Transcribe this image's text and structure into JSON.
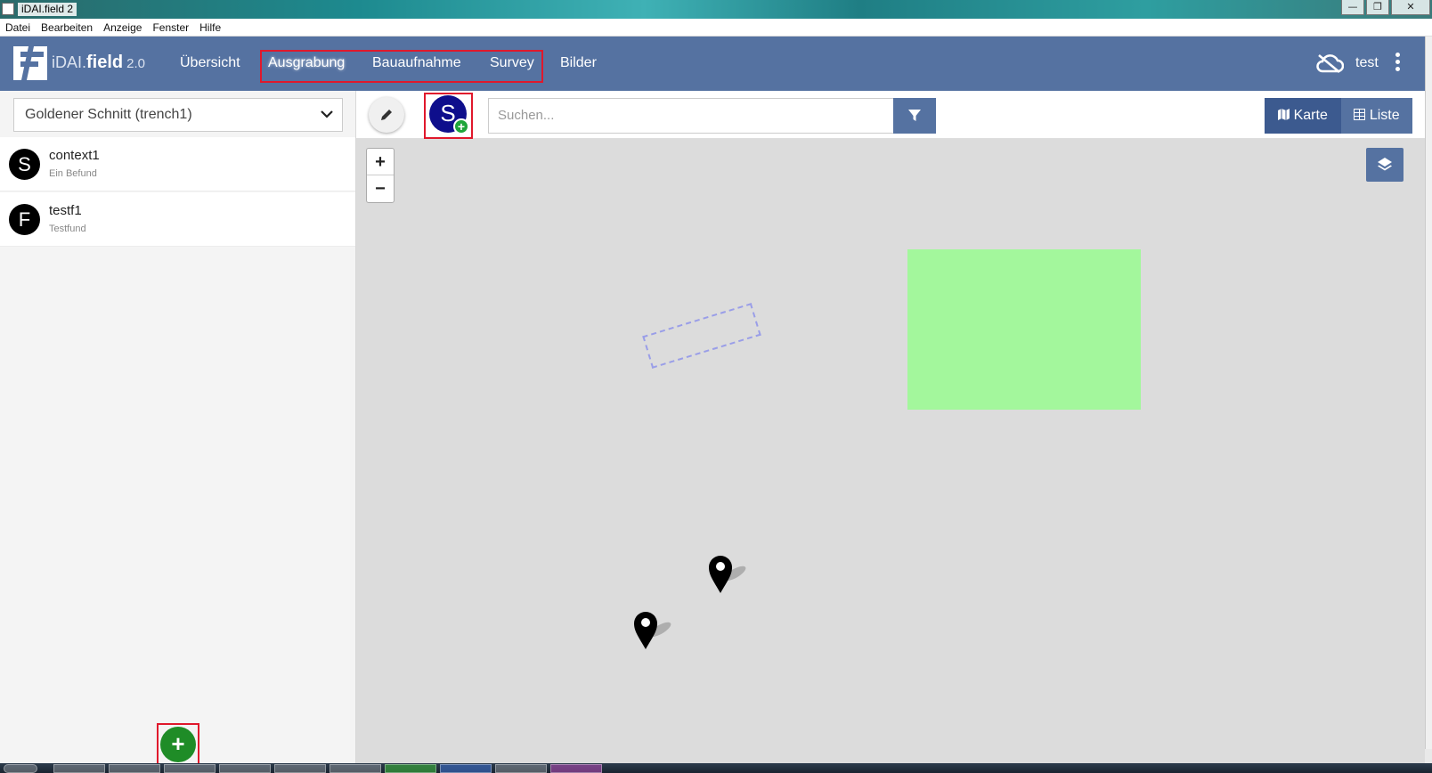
{
  "window": {
    "title": "iDAI.field 2",
    "minimize": "—",
    "restore": "❐",
    "close": "✕"
  },
  "menubar": [
    "Datei",
    "Bearbeiten",
    "Anzeige",
    "Fenster",
    "Hilfe"
  ],
  "navbar": {
    "brand_prefix": "iDAI.",
    "brand_name": "field",
    "version": "2.0",
    "items": [
      "Übersicht",
      "Ausgrabung",
      "Bauaufnahme",
      "Survey",
      "Bilder"
    ],
    "user": "test"
  },
  "leftpanel": {
    "operation_select": "Goldener Schnitt (trench1)",
    "items": [
      {
        "avatar": "S",
        "title": "context1",
        "subtitle": "Ein Befund"
      },
      {
        "avatar": "F",
        "title": "testf1",
        "subtitle": "Testfund"
      }
    ],
    "add_label": "+"
  },
  "toolbar": {
    "create_letter": "S",
    "create_plus": "+",
    "search_placeholder": "Suchen...",
    "view_map": "Karte",
    "view_list": "Liste"
  },
  "map": {
    "zoom_in": "+",
    "zoom_out": "−"
  },
  "colors": {
    "navbar": "#5572a1",
    "highlight": "#e0182c",
    "polygon": "#a3f79c",
    "add_button": "#1f8c27",
    "create_button": "#0e0e8c"
  },
  "icons": [
    "cloud-off-icon",
    "kebab-menu-icon",
    "pencil-icon",
    "filter-icon",
    "map-icon",
    "list-icon",
    "layers-icon",
    "map-pin-icon",
    "chevron-down-icon"
  ]
}
